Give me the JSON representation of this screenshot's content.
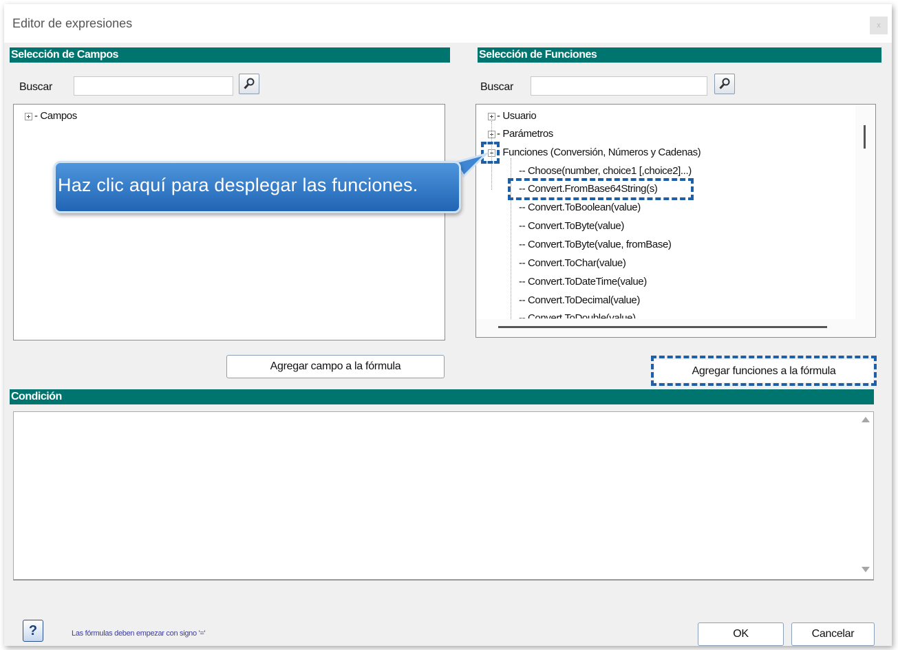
{
  "window": {
    "title": "Editor de expresiones",
    "close_glyph": "x"
  },
  "fields": {
    "header": "Selección de Campos",
    "search_label": "Buscar",
    "search_value": "",
    "tree": [
      {
        "label": "Campos",
        "expander": "plus"
      }
    ],
    "add_button": "Agregar campo a la fórmula"
  },
  "functions": {
    "header": "Selección de Funciones",
    "search_label": "Buscar",
    "search_value": "",
    "tree": [
      {
        "label": "Usuario",
        "expander": "plus"
      },
      {
        "label": "Parámetros",
        "expander": "plus"
      },
      {
        "label": "Funciones (Conversión, Números y Cadenas)",
        "expander": "minus"
      }
    ],
    "children": [
      "Choose(number, choice1 [,choice2]...)",
      "Convert.FromBase64String(s)",
      "Convert.ToBoolean(value)",
      "Convert.ToByte(value)",
      "Convert.ToByte(value, fromBase)",
      "Convert.ToChar(value)",
      "Convert.ToDateTime(value)",
      "Convert.ToDecimal(value)",
      "Convert.ToDouble(value)"
    ],
    "add_button": "Agregar funciones a la fórmula"
  },
  "condition": {
    "header": "Condición",
    "value": ""
  },
  "callout": {
    "text": "Haz clic aquí para desplegar las funciones."
  },
  "footer": {
    "help_glyph": "?",
    "hint": "Las fórmulas deben empezar con signo '='",
    "ok_label": "OK",
    "cancel_label": "Cancelar"
  },
  "icons": {
    "search": "magnifier-icon",
    "expand": "plus-box-icon",
    "collapse": "minus-box-icon",
    "scroll_up": "triangle-up-icon",
    "scroll_down": "triangle-down-icon"
  },
  "colors": {
    "header_bg": "#00756f",
    "callout_bg": "#2f7bcc",
    "highlight_dash": "#1f5fa8",
    "window_bg": "#f0f0f0"
  }
}
